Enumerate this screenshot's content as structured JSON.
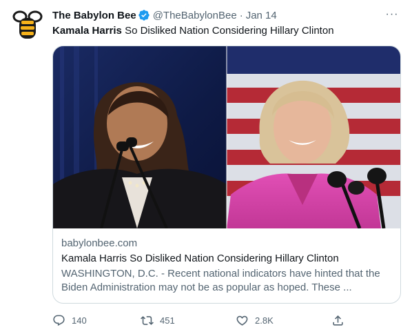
{
  "tweet": {
    "author_name": "The Babylon Bee",
    "handle": "@TheBabylonBee",
    "separator": "·",
    "date": "Jan 14",
    "more_label": "···",
    "text_bold": "Kamala Harris",
    "text_rest": " So Disliked Nation Considering Hillary Clinton"
  },
  "card": {
    "domain": "babylonbee.com",
    "title": "Kamala Harris So Disliked Nation Considering Hillary Clinton",
    "description": "WASHINGTON, D.C. - Recent national indicators have hinted that the Biden Administration may not be as popular as hoped. These ..."
  },
  "actions": {
    "reply_count": "140",
    "retweet_count": "451",
    "like_count": "2.8K"
  },
  "icons": {
    "avatar": "bee-logo-icon",
    "verified": "verified-badge-icon",
    "more": "more-icon",
    "reply": "reply-icon",
    "retweet": "retweet-icon",
    "like": "heart-icon",
    "share": "share-icon"
  },
  "colors": {
    "verified_blue": "#1d9bf0",
    "secondary_text": "#536471",
    "border": "#cfd9de",
    "bee_yellow": "#f6b21a"
  }
}
